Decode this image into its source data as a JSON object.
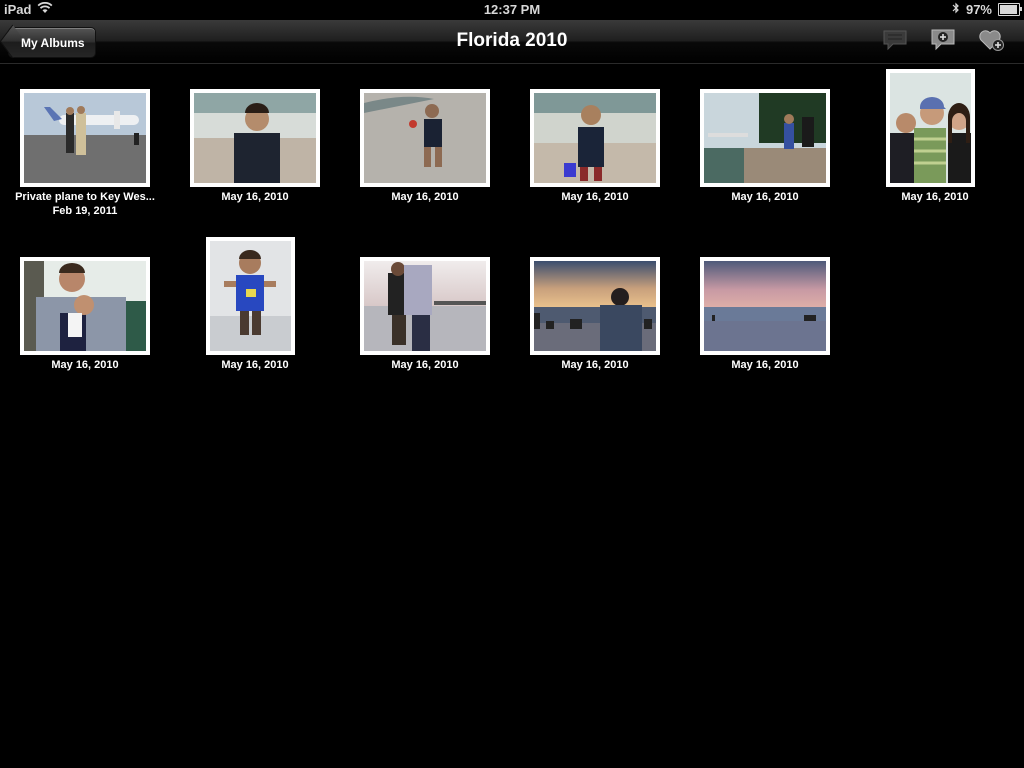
{
  "status": {
    "device": "iPad",
    "time": "12:37 PM",
    "battery": "97%",
    "battery_level": 0.97
  },
  "nav": {
    "back_label": "My Albums",
    "title": "Florida 2010",
    "icons": [
      "comment-icon",
      "add-comment-icon",
      "add-favorite-icon"
    ]
  },
  "photos": [
    {
      "title": "Private plane to Key Wes...",
      "date": "Feb 19, 2011"
    },
    {
      "date": "May 16, 2010"
    },
    {
      "date": "May 16, 2010"
    },
    {
      "date": "May 16, 2010"
    },
    {
      "date": "May 16, 2010"
    },
    {
      "date": "May 16, 2010"
    },
    {
      "date": "May 16, 2010"
    },
    {
      "date": "May 16, 2010"
    },
    {
      "date": "May 16, 2010"
    },
    {
      "date": "May 16, 2010"
    },
    {
      "date": "May 16, 2010"
    }
  ]
}
